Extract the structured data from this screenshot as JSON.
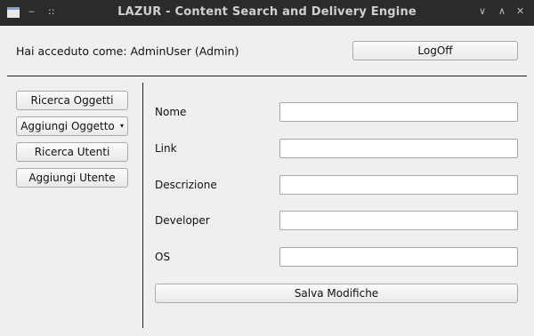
{
  "window": {
    "title": "LAZUR - Content Search and Delivery Engine",
    "menu_glyph": "‒",
    "pin_glyph": "::",
    "ctrl_glyphs": [
      "∨",
      "∧",
      "✕"
    ]
  },
  "header": {
    "logged_in_text": "Hai acceduto come: AdminUser (Admin)",
    "logoff_label": "LogOff"
  },
  "sidebar": {
    "items": [
      {
        "label": "Ricerca Oggetti"
      },
      {
        "label": "Aggiungi Oggetto",
        "has_dropdown": true
      },
      {
        "label": "Ricerca Utenti"
      },
      {
        "label": "Aggiungi Utente"
      }
    ]
  },
  "form": {
    "fields": [
      {
        "label": "Nome",
        "value": ""
      },
      {
        "label": "Link",
        "value": ""
      },
      {
        "label": "Descrizione",
        "value": ""
      },
      {
        "label": "Developer",
        "value": ""
      },
      {
        "label": "OS",
        "value": ""
      }
    ],
    "save_label": "Salva Modifiche"
  }
}
